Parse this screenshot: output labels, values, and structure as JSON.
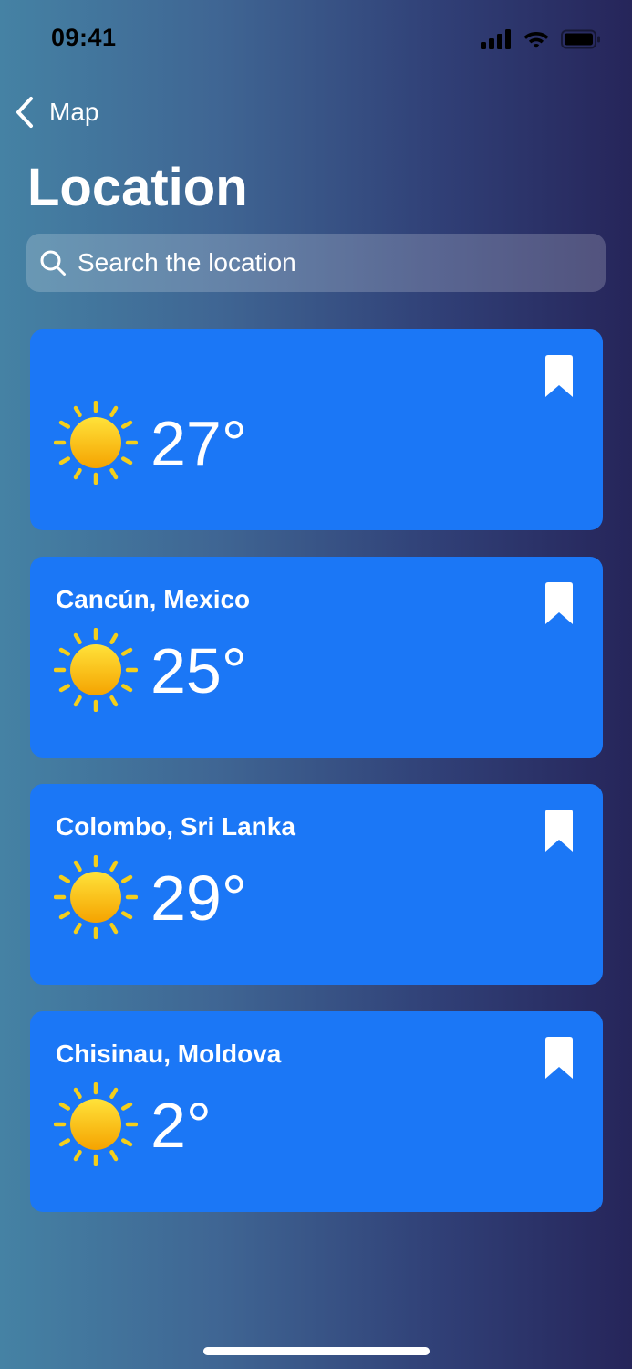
{
  "status_bar": {
    "time": "09:41"
  },
  "nav": {
    "back_label": "Map"
  },
  "page": {
    "title": "Location"
  },
  "search": {
    "placeholder": "Search the location",
    "value": ""
  },
  "locations": [
    {
      "name": "",
      "temperature": "27°",
      "condition_icon": "sun-icon",
      "bookmark_icon": "bookmark-icon"
    },
    {
      "name": "Cancún, Mexico",
      "temperature": "25°",
      "condition_icon": "sun-icon",
      "bookmark_icon": "bookmark-icon"
    },
    {
      "name": "Colombo, Sri Lanka",
      "temperature": "29°",
      "condition_icon": "sun-icon",
      "bookmark_icon": "bookmark-icon"
    },
    {
      "name": "Chisinau, Moldova",
      "temperature": "2°",
      "condition_icon": "sun-icon",
      "bookmark_icon": "bookmark-icon"
    }
  ],
  "colors": {
    "card_background": "#1b77f6",
    "sun_core": "#fcc419",
    "sun_rays": "#f4cf1c",
    "text": "#ffffff"
  }
}
